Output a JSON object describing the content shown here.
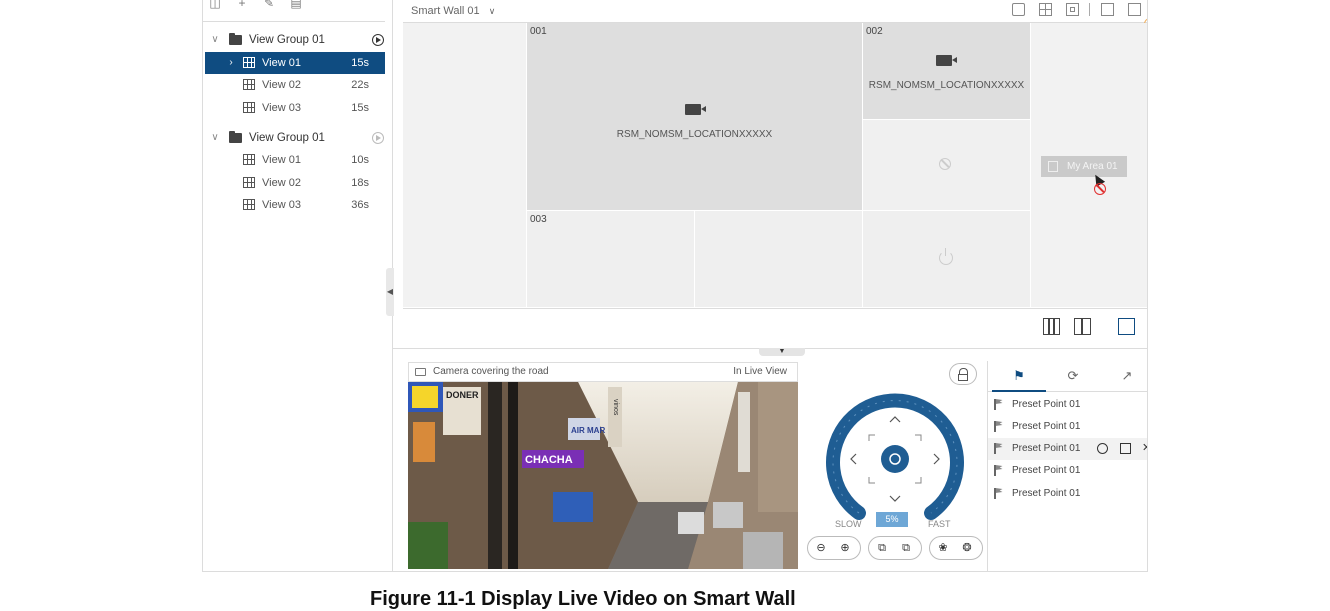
{
  "sidebar": {
    "toolbar": [
      "add-view-group-icon",
      "plus-icon",
      "edit-icon",
      "delete-icon"
    ],
    "groups": [
      {
        "label": "View Group 01",
        "playing": true,
        "views": [
          {
            "label": "View 01",
            "duration": "15s",
            "selected": true
          },
          {
            "label": "View 02",
            "duration": "22s"
          },
          {
            "label": "View 03",
            "duration": "15s"
          }
        ]
      },
      {
        "label": "View Group 01",
        "playing": false,
        "views": [
          {
            "label": "View 01",
            "duration": "10s"
          },
          {
            "label": "View 02",
            "duration": "18s"
          },
          {
            "label": "View 03",
            "duration": "36s"
          }
        ]
      }
    ]
  },
  "wall": {
    "title": "Smart Wall 01",
    "cells": [
      {
        "num": "001",
        "location": "RSM_NOMSM_LOCATIONXXXXX"
      },
      {
        "num": "002",
        "location": "RSM_NOMSM_LOCATIONXXXXX"
      },
      {
        "num": "003"
      }
    ],
    "drag_label": "My Area 01"
  },
  "live": {
    "title": "Camera covering the road",
    "mode": "In Live View",
    "video_signs": [
      "DONER",
      "CHACHA",
      "AIR MAR",
      "vinos"
    ]
  },
  "ptz": {
    "speed_slow": "SLOW",
    "speed_fast": "FAST",
    "speed_value": "5%",
    "speed_level": 0.05
  },
  "preset": {
    "tabs": [
      "flag-icon",
      "refresh-icon",
      "trend-icon"
    ],
    "items": [
      "Preset Point 01",
      "Preset Point 01",
      "Preset Point 01",
      "Preset Point 01",
      "Preset Point 01"
    ]
  },
  "colors": {
    "accent": "#0f4c81",
    "ptz_ring": "#1f5d93",
    "speed": "#6ea7d6"
  },
  "caption": "Figure 11-1 Display Live Video on Smart Wall"
}
